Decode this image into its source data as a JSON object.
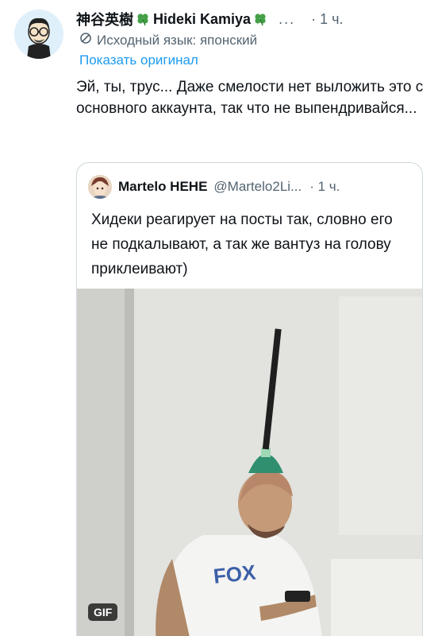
{
  "author": {
    "name_jp": "神谷英樹",
    "name_en": "Hideki Kamiya",
    "more_dots": "...",
    "time": "· 1 ч."
  },
  "translation": {
    "label": "Исходный язык: японский",
    "show_original": "Показать оригинал"
  },
  "tweet": {
    "text": "Эй, ты, трус... Даже смелости нет выложить это с основного аккаунта, так что не выпендривайся..."
  },
  "quote": {
    "name": "Martelo HEHE",
    "handle": "@Martelo2Li...",
    "time": "· 1 ч.",
    "text": "Хидеки реагирует на посты так, словно его не подкалывают, а так же вантуз на голову приклеивают)",
    "media_badge": "GIF",
    "shirt_text": "FOX"
  },
  "colors": {
    "link": "#1d9bf0",
    "secondary_text": "#536471",
    "clover": "#43a047"
  }
}
